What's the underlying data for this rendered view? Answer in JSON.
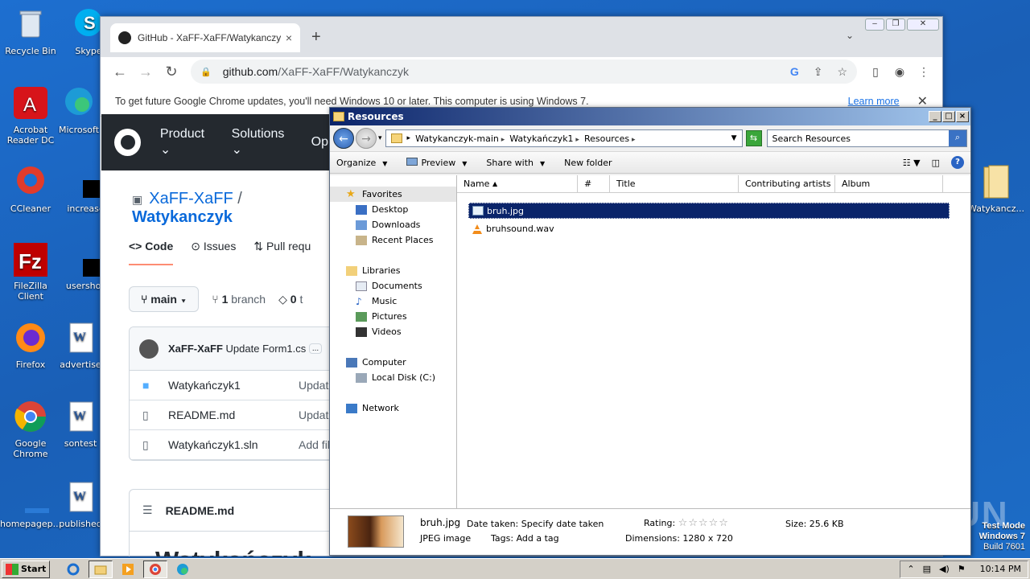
{
  "desktop": {
    "icons": [
      {
        "label": "Recycle Bin"
      },
      {
        "label": "Skype"
      },
      {
        "label": "Acrobat Reader DC"
      },
      {
        "label": "Microsoft"
      },
      {
        "label": "CCleaner"
      },
      {
        "label": "increased"
      },
      {
        "label": "FileZilla Client"
      },
      {
        "label": "usershosp"
      },
      {
        "label": "Firefox"
      },
      {
        "label": "advertise"
      },
      {
        "label": "Google Chrome"
      },
      {
        "label": "sontest"
      },
      {
        "label": "homepagep..."
      },
      {
        "label": "published"
      },
      {
        "label": "Watykancz..."
      }
    ],
    "watermark": "ANY RUN",
    "test_mode": {
      "line1": "Test Mode",
      "line2": "Windows 7",
      "line3": "Build 7601"
    }
  },
  "chrome": {
    "tab_title": "GitHub - XaFF-XaFF/Watykanczyk: R",
    "tab_close": "×",
    "new_tab": "+",
    "url_host": "github.com",
    "url_path": "/XaFF-XaFF/Watykanczyk",
    "infobar_text": "To get future Google Chrome updates, you'll need Windows 10 or later. This computer is using Windows 7.",
    "infobar_link": "Learn more",
    "github": {
      "nav": [
        "Product",
        "Solutions",
        "Op"
      ],
      "owner": "XaFF-XaFF",
      "slash": "/",
      "repo": "Watykanczyk",
      "tabs": [
        "Code",
        "Issues",
        "Pull requ"
      ],
      "branch_button": "main",
      "branch_count": "1",
      "branch_label": "branch",
      "tags_count": "0",
      "tags_label": "t",
      "commit_author": "XaFF-XaFF",
      "commit_message": "Update Form1.cs",
      "commit_more": "...",
      "files": [
        {
          "name": "Watykańczyk1",
          "message": "Updat",
          "type": "folder"
        },
        {
          "name": "README.md",
          "message": "Updat",
          "type": "file"
        },
        {
          "name": "Watykańczyk1.sln",
          "message": "Add fil",
          "type": "file"
        }
      ],
      "readme_header": "README.md",
      "readme_title": "Watykańczyk"
    }
  },
  "explorer": {
    "title": "Resources",
    "breadcrumbs": [
      "Watykanczyk-main",
      "Watykańczyk1",
      "Resources"
    ],
    "search_placeholder": "Search Resources",
    "commands": {
      "organize": "Organize",
      "preview": "Preview",
      "share": "Share with",
      "new_folder": "New folder"
    },
    "nav": {
      "favorites": "Favorites",
      "fav_items": [
        "Desktop",
        "Downloads",
        "Recent Places"
      ],
      "libraries": "Libraries",
      "lib_items": [
        "Documents",
        "Music",
        "Pictures",
        "Videos"
      ],
      "computer": "Computer",
      "comp_items": [
        "Local Disk (C:)"
      ],
      "network": "Network"
    },
    "columns": [
      "Name",
      "#",
      "Title",
      "Contributing artists",
      "Album"
    ],
    "files": [
      {
        "name": "bruh.jpg",
        "selected": true
      },
      {
        "name": "bruhsound.wav",
        "selected": false
      }
    ],
    "details": {
      "filename": "bruh.jpg",
      "filetype": "JPEG image",
      "date_taken_label": "Date taken:",
      "date_taken_value": "Specify date taken",
      "tags_label": "Tags:",
      "tags_value": "Add a tag",
      "rating_label": "Rating:",
      "rating_value": 0,
      "dimensions_label": "Dimensions:",
      "dimensions_value": "1280 x 720",
      "size_label": "Size:",
      "size_value": "25.6 KB"
    }
  },
  "taskbar": {
    "start_label": "Start",
    "clock": "10:14 PM"
  }
}
